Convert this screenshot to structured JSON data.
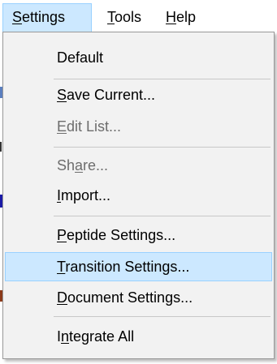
{
  "menubar": {
    "items": [
      {
        "pre": "",
        "key": "S",
        "post": "ettings"
      },
      {
        "pre": "",
        "key": "T",
        "post": "ools"
      },
      {
        "pre": "",
        "key": "H",
        "post": "elp"
      }
    ]
  },
  "menu": {
    "items": [
      {
        "pre": "Default",
        "key": "",
        "post": ""
      },
      {
        "pre": "",
        "key": "S",
        "post": "ave Current..."
      },
      {
        "pre": "",
        "key": "E",
        "post": "dit List..."
      },
      {
        "pre": "Sh",
        "key": "a",
        "post": "re..."
      },
      {
        "pre": "",
        "key": "I",
        "post": "mport..."
      },
      {
        "pre": "",
        "key": "P",
        "post": "eptide Settings..."
      },
      {
        "pre": "",
        "key": "T",
        "post": "ransition Settings..."
      },
      {
        "pre": "",
        "key": "D",
        "post": "ocument Settings..."
      },
      {
        "pre": "I",
        "key": "n",
        "post": "tegrate All"
      }
    ]
  },
  "colors": {
    "highlight_fill": "#cce8ff",
    "highlight_border": "#99d1ff",
    "disabled_text": "#6d6d6d",
    "menu_background": "#f2f2f2"
  }
}
